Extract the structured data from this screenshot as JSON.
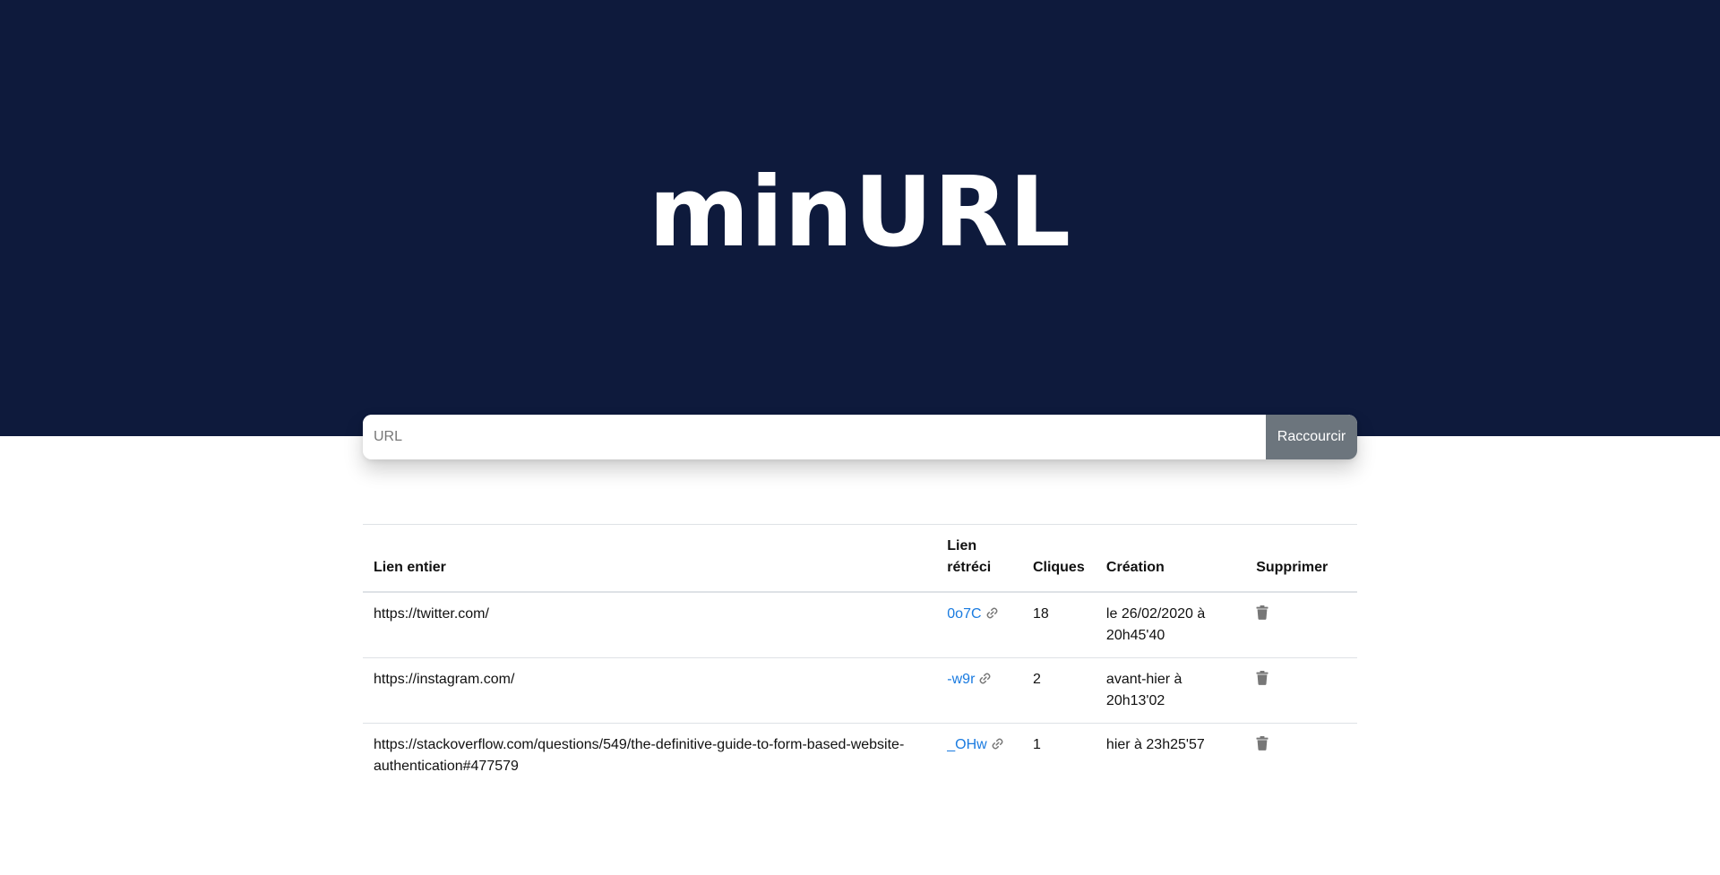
{
  "header": {
    "brand_title": "minURL"
  },
  "shortener": {
    "input_placeholder": "URL",
    "input_value": "",
    "submit_label": "Raccourcir"
  },
  "table": {
    "headers": {
      "full_link": "Lien entier",
      "short_link": "Lien rétréci",
      "clicks": "Cliques",
      "created": "Création",
      "delete": "Supprimer"
    },
    "rows": [
      {
        "full_link": "https://twitter.com/",
        "short_code": "0o7C",
        "clicks": "18",
        "created": "le 26/02/2020 à 20h45'40"
      },
      {
        "full_link": "https://instagram.com/",
        "short_code": "-w9r",
        "clicks": "2",
        "created": "avant-hier à 20h13'02"
      },
      {
        "full_link": "https://stackoverflow.com/questions/549/the-definitive-guide-to-form-based-website-authentication#477579",
        "short_code": "_OHw",
        "clicks": "1",
        "created": "hier à 23h25'57"
      }
    ]
  },
  "icons": {
    "copy_link": "link-icon",
    "delete": "trash-icon"
  },
  "colors": {
    "hero_background": "#0e1a3c",
    "button_background": "#6c757d",
    "link": "#1a7be0",
    "icon_gray": "#777777"
  }
}
